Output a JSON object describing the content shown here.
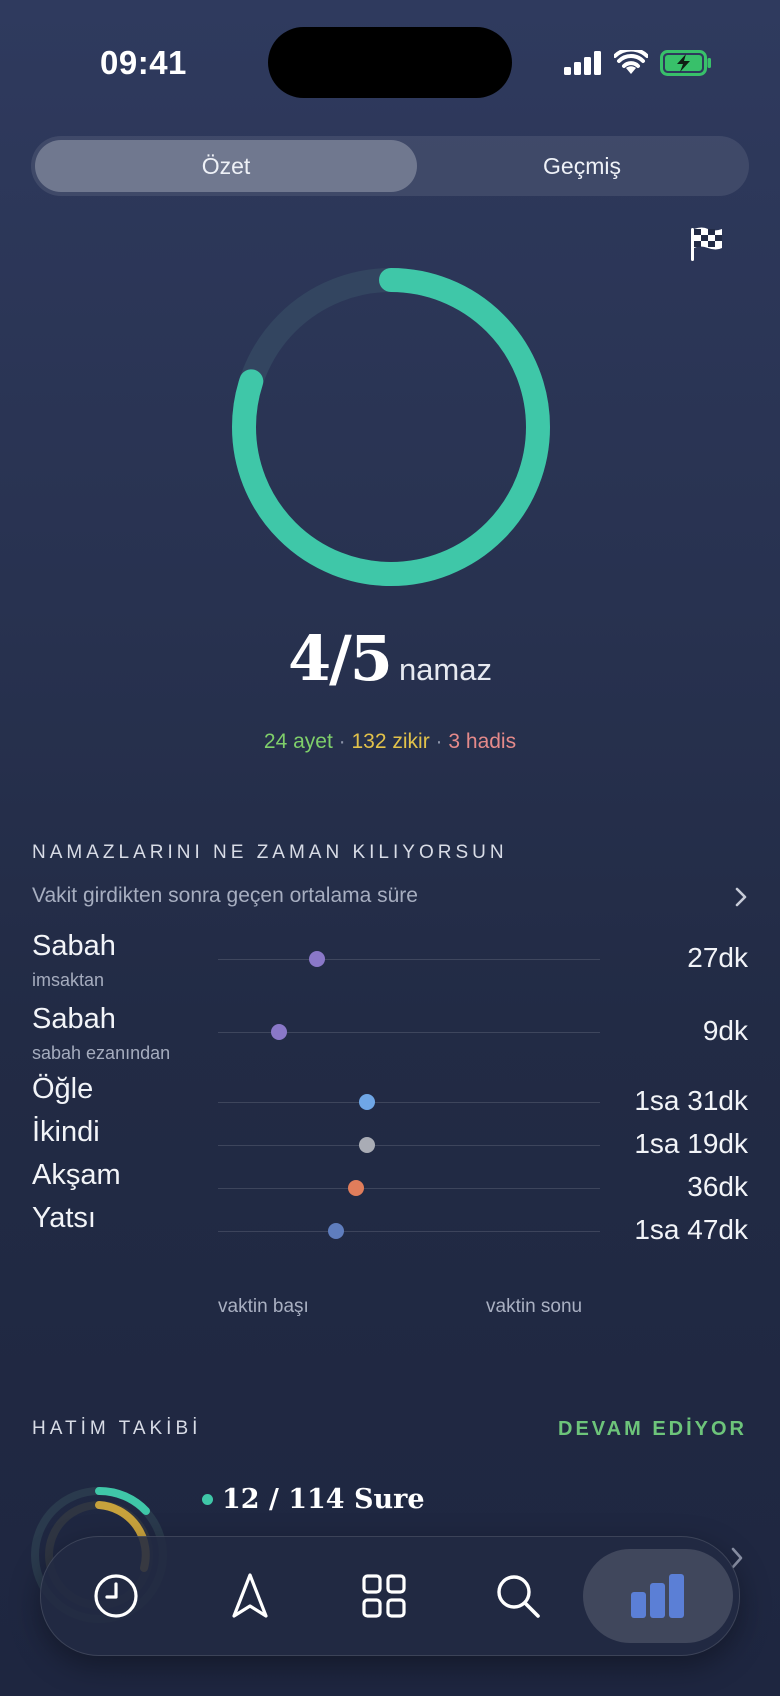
{
  "status_bar": {
    "time": "09:41"
  },
  "segments": {
    "active": "Özet",
    "inactive": "Geçmiş"
  },
  "summary": {
    "progress_fraction": 0.8,
    "count": "4/5",
    "unit": "namaz",
    "stats": {
      "ayet": "24 ayet",
      "zikir": "132 zikir",
      "hadis": "3 hadis",
      "separator": "·"
    }
  },
  "timing": {
    "title": "NAMAZLARINI NE ZAMAN KILIYORSUN",
    "subtitle": "Vakit girdikten sonra geçen ortalama süre",
    "rows": [
      {
        "name": "Sabah",
        "sub": "imsaktan",
        "value": "27dk",
        "position": 0.26,
        "color": "#8a78c8"
      },
      {
        "name": "Sabah",
        "sub": "sabah ezanından",
        "value": "9dk",
        "position": 0.16,
        "color": "#8a78c8"
      },
      {
        "name": "Öğle",
        "sub": "",
        "value": "1sa 31dk",
        "position": 0.39,
        "color": "#6fa6e6"
      },
      {
        "name": "İkindi",
        "sub": "",
        "value": "1sa 19dk",
        "position": 0.39,
        "color": "#a9acb5"
      },
      {
        "name": "Akşam",
        "sub": "",
        "value": "36dk",
        "position": 0.36,
        "color": "#e07d5b"
      },
      {
        "name": "Yatsı",
        "sub": "",
        "value": "1sa 47dk",
        "position": 0.31,
        "color": "#5f7dbd"
      }
    ],
    "axis_start": "vaktin başı",
    "axis_end": "vaktin sonu"
  },
  "hatim": {
    "title": "HATİM TAKİBİ",
    "status": "DEVAM EDİYOR",
    "sure_progress": "12 / 114 Sure"
  },
  "colors": {
    "accent": "#3fc7a8",
    "ring_track": "#3a4a63",
    "status_green": "#6dc47a"
  },
  "tabbar": {
    "tabs": [
      {
        "icon": "clock-icon"
      },
      {
        "icon": "compass-arrow-icon"
      },
      {
        "icon": "grid-icon"
      },
      {
        "icon": "search-icon"
      },
      {
        "icon": "stats-icon",
        "active": true
      }
    ]
  }
}
